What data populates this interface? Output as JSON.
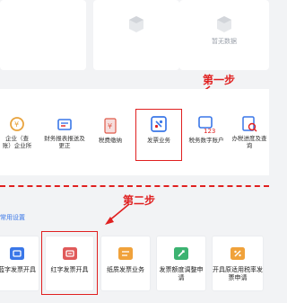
{
  "empty_state": {
    "label": "暂无数据"
  },
  "steps": {
    "step1": "第一步",
    "step2": "第二步"
  },
  "services": [
    {
      "label": "企业（查账）企业所"
    },
    {
      "label": "财务报表报送及更正"
    },
    {
      "label": "税费缴纳"
    },
    {
      "label": "发票业务"
    },
    {
      "label": "税务数字账户"
    },
    {
      "label": "办税进度及查询"
    }
  ],
  "section": {
    "title": "常用设置"
  },
  "invoice_tiles": [
    {
      "label": "蓝字发票开具"
    },
    {
      "label": "红字发票开具"
    },
    {
      "label": "纸质发票业务"
    },
    {
      "label": "发票额度调整申请"
    },
    {
      "label": "开具原适用税率发票申请"
    }
  ],
  "colors": {
    "accent_blue": "#3a77e8",
    "annotation_red": "#e02020"
  }
}
